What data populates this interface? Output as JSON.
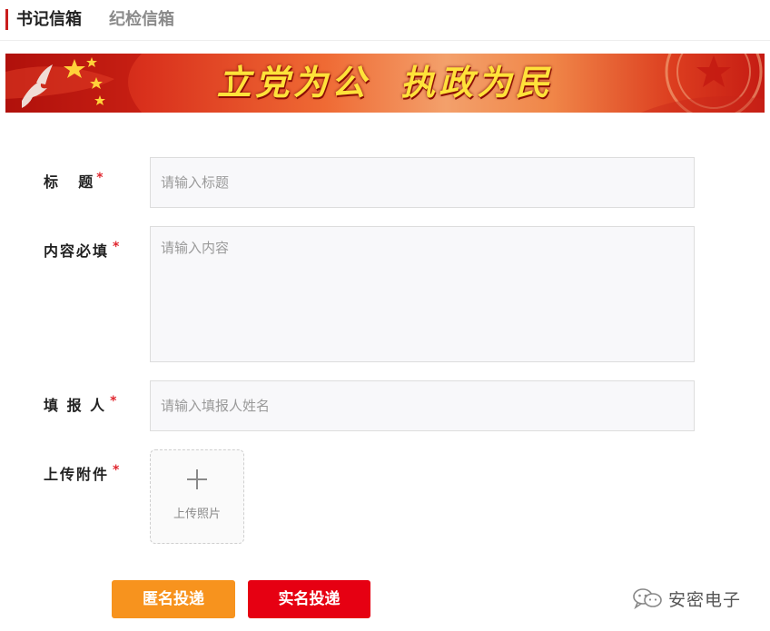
{
  "tabs": [
    {
      "label": "书记信箱",
      "active": true
    },
    {
      "label": "纪检信箱",
      "active": false
    }
  ],
  "banner": {
    "slogan": "立党为公  执政为民"
  },
  "form": {
    "title": {
      "label": "标    题",
      "required_mark": "*",
      "placeholder": "请输入标题",
      "value": ""
    },
    "content": {
      "label": "内容必填",
      "required_mark": "*",
      "placeholder": "请输入内容",
      "value": ""
    },
    "reporter": {
      "label": "填 报 人",
      "required_mark": "*",
      "placeholder": "请输入填报人姓名",
      "value": ""
    },
    "attachment": {
      "label": "上传附件",
      "required_mark": "*",
      "upload_icon": "plus-icon",
      "upload_text": "上传照片"
    }
  },
  "buttons": {
    "anonymous": "匿名投递",
    "real_name": "实名投递"
  },
  "watermark": {
    "icon": "wechat-icon",
    "text": "安密电子"
  },
  "colors": {
    "accent_red": "#c91d1d",
    "required_red": "#e0262e",
    "anonymous_button": "#f7931e",
    "real_name_button": "#e60012",
    "slogan_yellow": "#ffe23a"
  }
}
